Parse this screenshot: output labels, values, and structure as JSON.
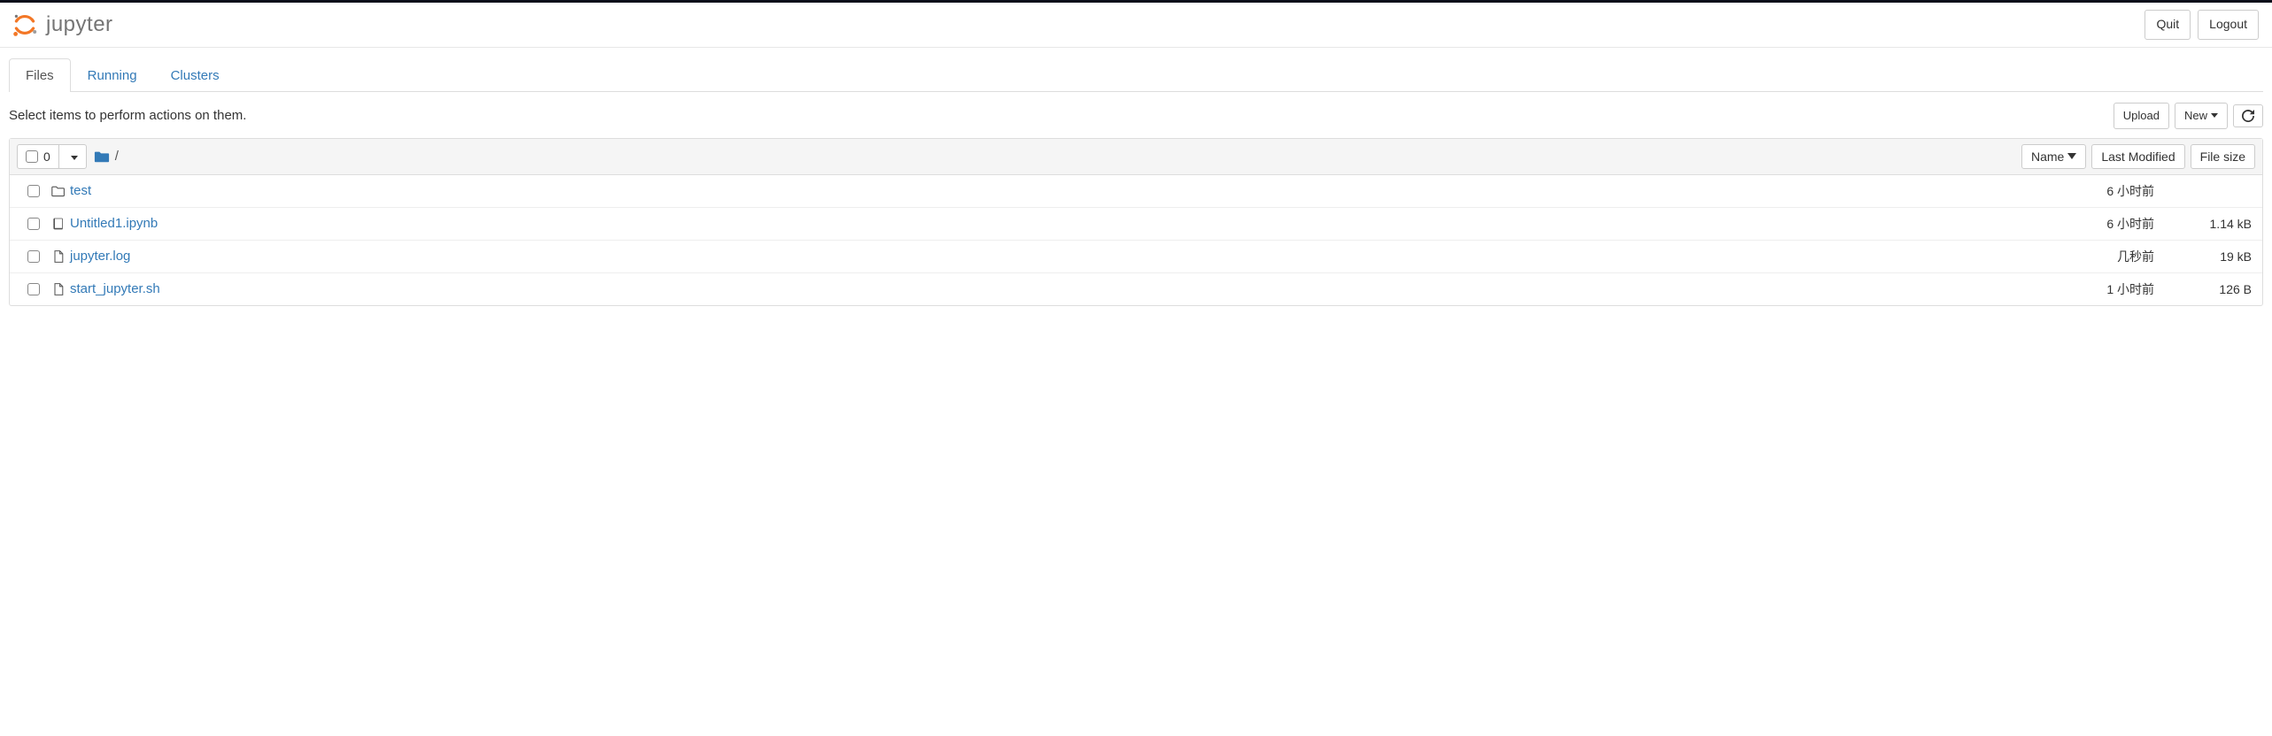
{
  "header": {
    "logo_text": "jupyter",
    "quit_label": "Quit",
    "logout_label": "Logout"
  },
  "tabs": {
    "files": "Files",
    "running": "Running",
    "clusters": "Clusters"
  },
  "action_bar": {
    "hint": "Select items to perform actions on them.",
    "upload_label": "Upload",
    "new_label": "New"
  },
  "panel_header": {
    "selected_count": "0",
    "breadcrumb_sep": "/",
    "sort_name": "Name",
    "sort_modified": "Last Modified",
    "sort_size": "File size"
  },
  "rows": [
    {
      "type": "folder",
      "name": "test",
      "modified": "6 小时前",
      "size": ""
    },
    {
      "type": "notebook",
      "name": "Untitled1.ipynb",
      "modified": "6 小时前",
      "size": "1.14 kB"
    },
    {
      "type": "file",
      "name": "jupyter.log",
      "modified": "几秒前",
      "size": "19 kB"
    },
    {
      "type": "file",
      "name": "start_jupyter.sh",
      "modified": "1 小时前",
      "size": "126 B"
    }
  ]
}
